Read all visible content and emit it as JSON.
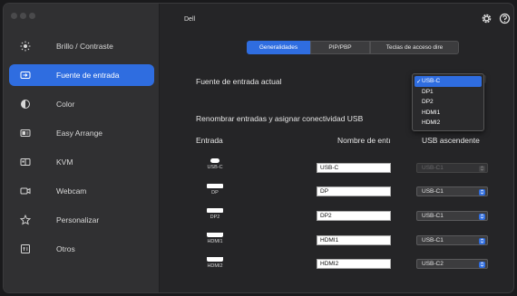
{
  "app": {
    "title": "Dell"
  },
  "sidebar": {
    "items": [
      {
        "label": "Brillo / Contraste",
        "icon": "brightness-icon",
        "active": false
      },
      {
        "label": "Fuente de entrada",
        "icon": "input-source-icon",
        "active": true
      },
      {
        "label": "Color",
        "icon": "color-icon",
        "active": false
      },
      {
        "label": "Easy Arrange",
        "icon": "easy-arrange-icon",
        "active": false
      },
      {
        "label": "KVM",
        "icon": "kvm-icon",
        "active": false
      },
      {
        "label": "Webcam",
        "icon": "webcam-icon",
        "active": false
      },
      {
        "label": "Personalizar",
        "icon": "star-icon",
        "active": false
      },
      {
        "label": "Otros",
        "icon": "others-icon",
        "active": false
      }
    ]
  },
  "tabs": [
    {
      "label": "Generalidades",
      "active": true
    },
    {
      "label": "PIP/PBP",
      "active": false
    },
    {
      "label": "Teclas de acceso dire",
      "active": false
    }
  ],
  "current_input": {
    "label": "Fuente de entrada actual",
    "options": [
      "USB-C",
      "DP1",
      "DP2",
      "HDMI1",
      "HDMI2"
    ],
    "selected": "USB-C"
  },
  "rename": {
    "heading": "Renombrar entradas y asignar conectividad USB",
    "col_input": "Entrada",
    "col_name": "Nombre de entı",
    "col_usb": "USB ascendente",
    "rows": [
      {
        "port": "USB-C",
        "name": "USB-C",
        "usb": "USB-C1",
        "disabled": true
      },
      {
        "port": "DP",
        "name": "DP",
        "usb": "USB-C1",
        "disabled": false
      },
      {
        "port": "DP2",
        "name": "DP2",
        "usb": "USB-C1",
        "disabled": false
      },
      {
        "port": "HDMI1",
        "name": "HDMI1",
        "usb": "USB-C1",
        "disabled": false
      },
      {
        "port": "HDMI2",
        "name": "HDMI2",
        "usb": "USB-C2",
        "disabled": false
      }
    ]
  },
  "colors": {
    "accent": "#2f6de0",
    "background": "#252527",
    "sidebar": "#303032"
  }
}
